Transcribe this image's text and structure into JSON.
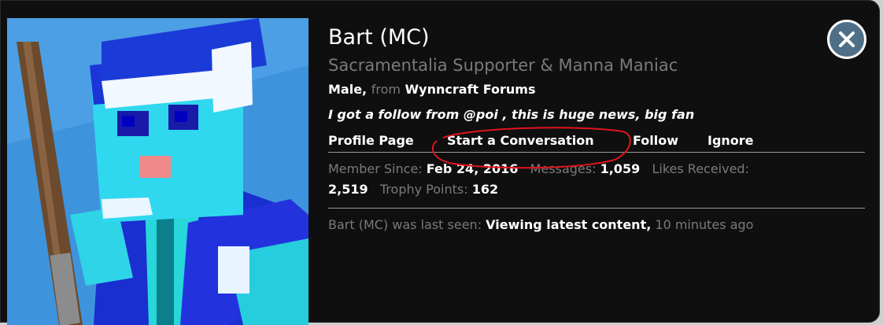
{
  "profile": {
    "name": "Bart (MC)",
    "user_title": "Sacramentalia Supporter & Manna Maniac",
    "gender": "Male,",
    "from_label": "from",
    "location": "Wynncraft Forums",
    "status_message": "I got a follow from @poi , this is huge news, big fan"
  },
  "links": {
    "profile_page": "Profile Page",
    "start_conversation": "Start a Conversation",
    "follow": "Follow",
    "ignore": "Ignore"
  },
  "stats": {
    "member_since_label": "Member Since:",
    "member_since_value": "Feb 24, 2016",
    "messages_label": "Messages:",
    "messages_value": "1,059",
    "likes_label": "Likes Received:",
    "likes_value": "2,519",
    "trophy_label": "Trophy Points:",
    "trophy_value": "162"
  },
  "last_seen": {
    "prefix": "Bart (MC) was last seen:",
    "activity": "Viewing latest content,",
    "time": "10 minutes ago"
  },
  "colors": {
    "card_bg": "#0f0f0f",
    "muted_text": "#7a7a7a",
    "close_button": "#4e6f87",
    "annotation_circle": "#e0141e",
    "avatar_bg": "#3e93dd"
  },
  "icons": {
    "close": "close-icon"
  }
}
